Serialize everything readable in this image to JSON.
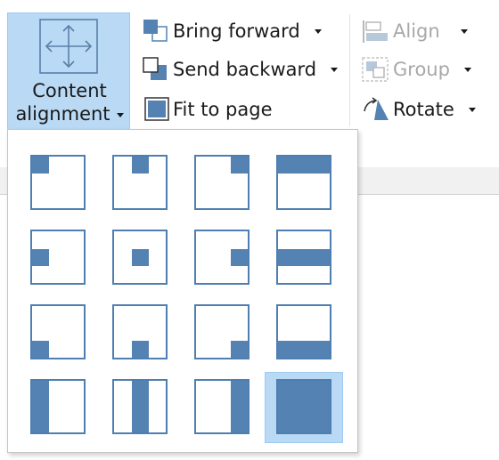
{
  "colors": {
    "accent": "#5382b3",
    "selected_bg": "#b9d9f4",
    "disabled_text": "#a8a8a8"
  },
  "content_alignment": {
    "label_line1": "Content",
    "label_line2": "alignment",
    "icon": "move-arrows-icon",
    "expanded": true
  },
  "arrange": {
    "bring_forward": {
      "label": "Bring forward",
      "icon": "bring-forward-icon",
      "has_dropdown": true
    },
    "send_backward": {
      "label": "Send backward",
      "icon": "send-backward-icon",
      "has_dropdown": true
    },
    "fit_to_page": {
      "label": "Fit to page",
      "icon": "fit-to-page-icon",
      "has_dropdown": false
    },
    "align": {
      "label": "Align",
      "icon": "align-icon",
      "has_dropdown": true,
      "enabled": false
    },
    "group": {
      "label": "Group",
      "icon": "group-icon",
      "has_dropdown": true,
      "enabled": false
    },
    "rotate": {
      "label": "Rotate",
      "icon": "rotate-icon",
      "has_dropdown": true,
      "enabled": true
    }
  },
  "alignment_options": [
    {
      "id": "top-left",
      "icon": "align-top-left-icon"
    },
    {
      "id": "top-center",
      "icon": "align-top-center-icon"
    },
    {
      "id": "top-right",
      "icon": "align-top-right-icon"
    },
    {
      "id": "top-stretch",
      "icon": "align-top-stretch-icon"
    },
    {
      "id": "middle-left",
      "icon": "align-middle-left-icon"
    },
    {
      "id": "center",
      "icon": "align-center-icon"
    },
    {
      "id": "middle-right",
      "icon": "align-middle-right-icon"
    },
    {
      "id": "middle-stretch",
      "icon": "align-middle-stretch-icon"
    },
    {
      "id": "bottom-left",
      "icon": "align-bottom-left-icon"
    },
    {
      "id": "bottom-center",
      "icon": "align-bottom-center-icon"
    },
    {
      "id": "bottom-right",
      "icon": "align-bottom-right-icon"
    },
    {
      "id": "bottom-stretch",
      "icon": "align-bottom-stretch-icon"
    },
    {
      "id": "left-stretch",
      "icon": "align-left-stretch-icon"
    },
    {
      "id": "center-stretch",
      "icon": "align-center-stretch-icon"
    },
    {
      "id": "right-stretch",
      "icon": "align-right-stretch-icon"
    },
    {
      "id": "fill",
      "icon": "align-fill-icon"
    }
  ],
  "selected_option": "fill"
}
